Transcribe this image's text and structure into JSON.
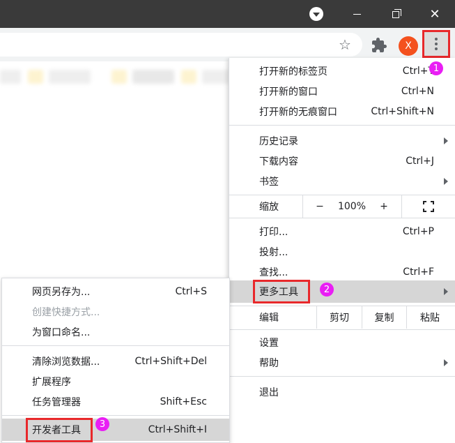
{
  "toolbar": {
    "profile_initial": "X"
  },
  "badges": {
    "one": "1",
    "two": "2",
    "three": "3"
  },
  "menu": {
    "new_tab": "打开新的标签页",
    "new_tab_sc": "Ctrl+T",
    "new_window": "打开新的窗口",
    "new_window_sc": "Ctrl+N",
    "incognito": "打开新的无痕窗口",
    "incognito_sc": "Ctrl+Shift+N",
    "history": "历史记录",
    "downloads": "下载内容",
    "downloads_sc": "Ctrl+J",
    "bookmarks": "书签",
    "zoom": {
      "label": "缩放",
      "minus": "−",
      "value": "100%",
      "plus": "+"
    },
    "print": "打印...",
    "print_sc": "Ctrl+P",
    "cast": "投射...",
    "find": "查找...",
    "find_sc": "Ctrl+F",
    "more_tools": "更多工具",
    "edit": {
      "label": "编辑",
      "cut": "剪切",
      "copy": "复制",
      "paste": "粘贴"
    },
    "settings": "设置",
    "help": "帮助",
    "exit": "退出"
  },
  "submenu": {
    "save_page": "网页另存为...",
    "save_page_sc": "Ctrl+S",
    "create_shortcut": "创建快捷方式...",
    "name_window": "为窗口命名...",
    "clear_data": "清除浏览数据...",
    "clear_data_sc": "Ctrl+Shift+Del",
    "extensions": "扩展程序",
    "task_manager": "任务管理器",
    "task_manager_sc": "Shift+Esc",
    "dev_tools": "开发者工具",
    "dev_tools_sc": "Ctrl+Shift+I"
  },
  "colors": {
    "highlight_box": "#e8282b",
    "badge": "#e91ef4",
    "avatar": "#f4511e"
  }
}
